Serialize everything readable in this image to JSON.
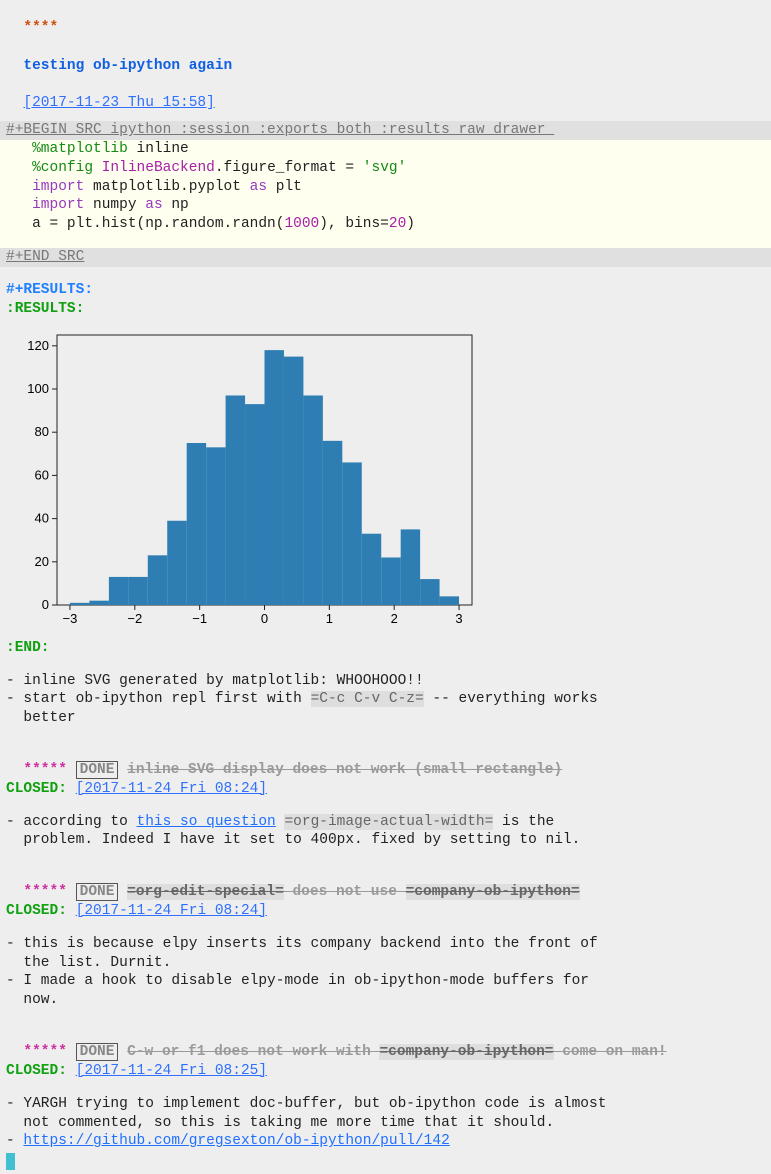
{
  "heading": {
    "stars": "****",
    "title": "testing ob-ipython again",
    "timestamp": "[2017-11-23 Thu 15:58]"
  },
  "src": {
    "begin": "#+BEGIN_SRC ipython :session :exports both :results raw drawer ",
    "end": "#+END_SRC",
    "l1_magic": "%matplotlib",
    "l1_rest": " inline",
    "l2_magic": "%config",
    "l2_cls": " InlineBackend",
    "l2_mid": ".figure_format = ",
    "l2_str": "'svg'",
    "l3_kw": "import",
    "l3_mod": " matplotlib.pyplot ",
    "l3_as": "as",
    "l3_alias": " plt",
    "l4_kw": "import",
    "l4_mod": " numpy ",
    "l4_as": "as",
    "l4_alias": " np",
    "l5_a": "a = plt.hist(np.random.randn(",
    "l5_n1": "1000",
    "l5_b": "), bins=",
    "l5_n2": "20",
    "l5_c": ")"
  },
  "results_hdr": "#+RESULTS:",
  "results_open": ":RESULTS:",
  "results_close": ":END:",
  "chart_data": {
    "type": "bar",
    "xlabel": "",
    "ylabel": "",
    "xlim": [
      -3.2,
      3.2
    ],
    "ylim": [
      0,
      125
    ],
    "xticks": [
      -3,
      -2,
      -1,
      0,
      1,
      2,
      3
    ],
    "yticks": [
      0,
      20,
      40,
      60,
      80,
      100,
      120
    ],
    "categories": [
      -3.0,
      -2.7,
      -2.4,
      -2.1,
      -1.8,
      -1.5,
      -1.2,
      -0.9,
      -0.6,
      -0.3,
      0.0,
      0.3,
      0.6,
      0.9,
      1.2,
      1.5,
      1.8,
      2.1,
      2.4,
      2.7
    ],
    "bin_width": 0.3,
    "values": [
      1,
      2,
      13,
      13,
      23,
      39,
      75,
      73,
      97,
      93,
      118,
      115,
      97,
      76,
      66,
      33,
      22,
      35,
      12,
      4
    ]
  },
  "bullets1": {
    "b1": "inline SVG generated by matplotlib: WHOOHOOO!!",
    "b2a": "start ob-ipython repl first with ",
    "b2code": "=C-c C-v C-z=",
    "b2b": " -- everything works",
    "b2c": "better"
  },
  "sub1": {
    "stars": "*****",
    "done": "DONE",
    "title": "inline SVG display does not work (small rectangle)",
    "closed_label": "CLOSED:",
    "closed_ts": "[2017-11-24 Fri 08:24]",
    "b1a": "according to ",
    "b1link": "this so question",
    "b1sp": " ",
    "b1code": "=org-image-actual-width=",
    "b1b": " is the",
    "b1c": "problem. Indeed I have it set to 400px. fixed by setting to nil."
  },
  "sub2": {
    "stars": "*****",
    "done": "DONE",
    "title_code1": "=org-edit-special=",
    "title_mid": " does not use ",
    "title_code2": "=company-ob-ipython=",
    "closed_label": "CLOSED:",
    "closed_ts": "[2017-11-24 Fri 08:24]",
    "b1a": "this is because elpy inserts its company backend into the front of",
    "b1b": "the list. Durnit.",
    "b2a": "I made a hook to disable elpy-mode in ob-ipython-mode buffers for",
    "b2b": "now."
  },
  "sub3": {
    "stars": "*****",
    "done": "DONE",
    "title_a": "C-w or f1 does not work with ",
    "title_code": "=company-ob-ipython=",
    "title_b": " come on man!",
    "closed_label": "CLOSED:",
    "closed_ts": "[2017-11-24 Fri 08:25]",
    "b1a": "YARGH trying to implement doc-buffer, but ob-ipython code is almost",
    "b1b": "not commented, so this is taking me more time that it should.",
    "b2link": "https://github.com/gregsexton/ob-ipython/pull/142"
  }
}
